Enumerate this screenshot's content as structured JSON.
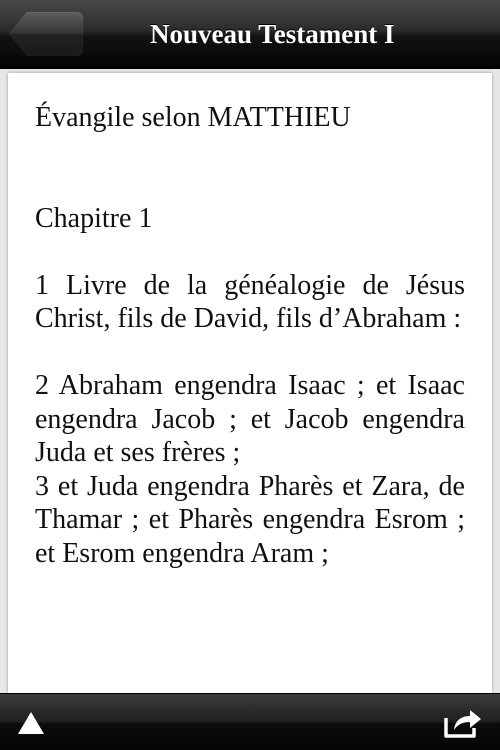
{
  "navbar": {
    "title": "Nouveau Testament I",
    "back_label": ""
  },
  "reader": {
    "book_title": "Évangile selon MATTHIEU",
    "chapter_title": "Chapitre 1",
    "verses": [
      "1 Livre de la généalogie de Jésus Christ, fils de David, fils d’Abraham :",
      "2 Abraham engendra Isaac ; et Isaac engendra Jacob ; et Jacob engendra Juda et ses frères ;",
      "3 et Juda engendra Pharès et Zara, de Thamar ; et Pharès engendra Esrom ; et Esrom engendra Aram ;"
    ]
  },
  "toolbar": {
    "left_icon": "up-triangle-icon",
    "right_icon": "share-icon"
  },
  "colors": {
    "bar_dark": "#0c0c0c",
    "page_bg": "#ffffff",
    "text": "#111111"
  }
}
